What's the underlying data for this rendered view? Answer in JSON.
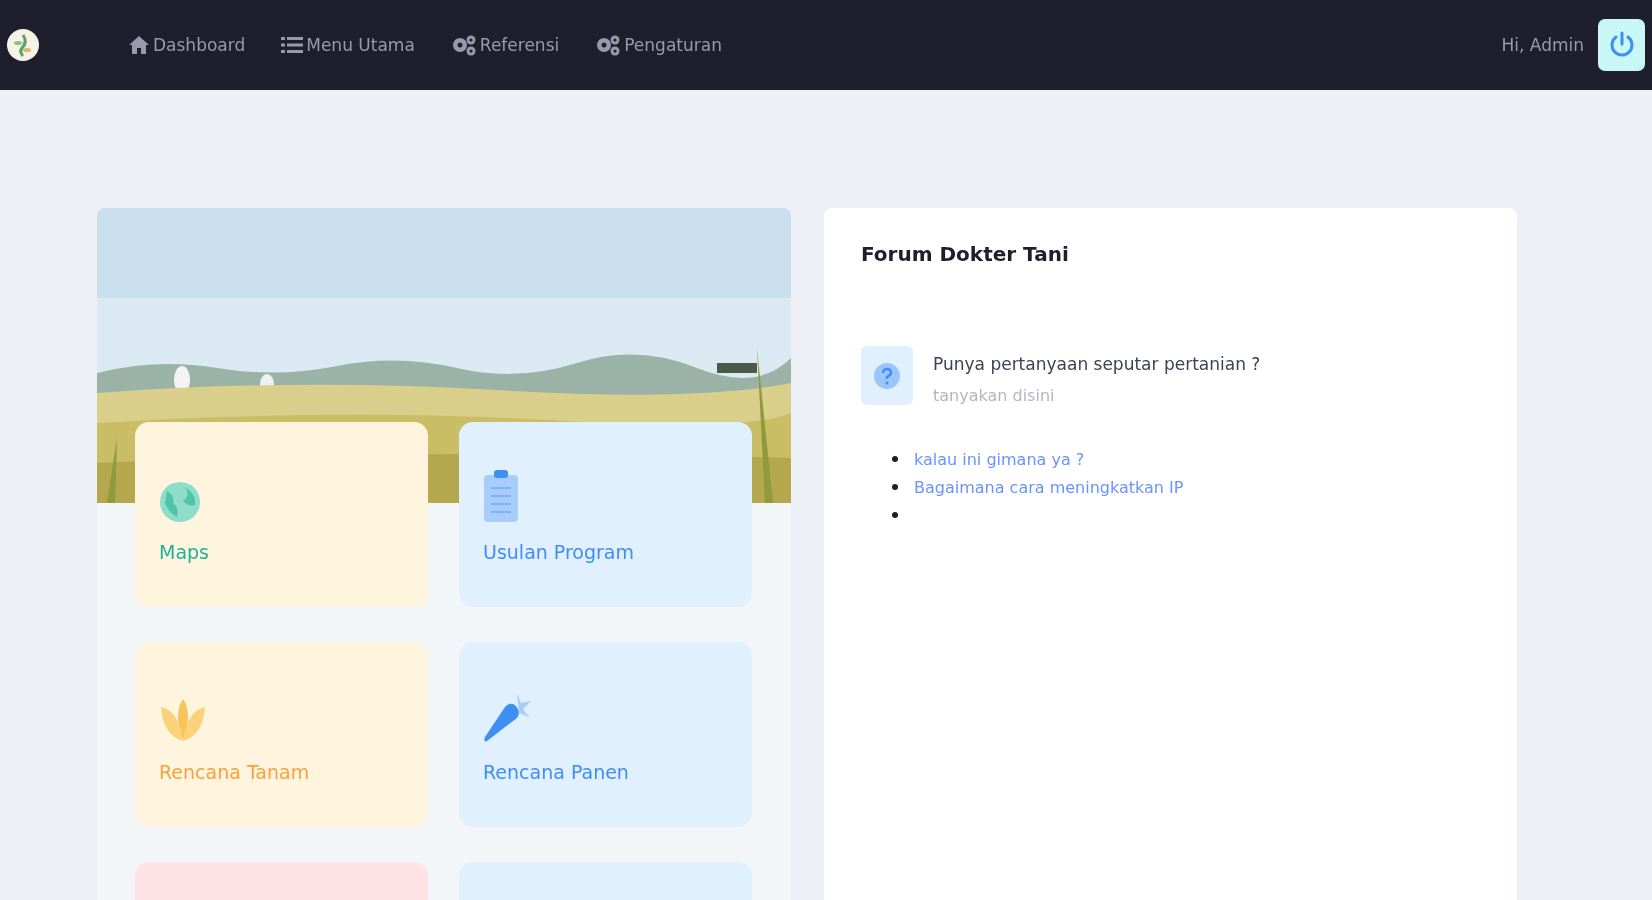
{
  "navbar": {
    "menu": [
      {
        "kind": "home",
        "label": "Dashboard"
      },
      {
        "kind": "list",
        "label": "Menu Utama"
      },
      {
        "kind": "gears",
        "label": "Referensi"
      },
      {
        "kind": "gears",
        "label": "Pengaturan"
      }
    ],
    "greeting": "Hi, Admin"
  },
  "tiles": [
    {
      "kind": "globe",
      "label": "Maps",
      "color": "#fff4de"
    },
    {
      "kind": "clipboard",
      "label": "Usulan Program",
      "color": "#e1f0ff"
    },
    {
      "kind": "lotus",
      "label": "Rencana Tanam",
      "color": "#fff4de"
    },
    {
      "kind": "carrot",
      "label": "Rencana Panen",
      "color": "#e1f0ff"
    },
    {
      "kind": "blank",
      "color": "#ffe2e5"
    },
    {
      "kind": "blank",
      "color": "#e1f0ff"
    }
  ],
  "forum": {
    "title": "Forum Dokter Tani",
    "prompt": {
      "question": "Punya pertanyaan seputar pertanian ?",
      "hint": "tanyakan disini"
    },
    "questions": [
      {
        "kind": "link",
        "text": "kalau ini gimana ya ?"
      },
      {
        "kind": "link",
        "text": "Bagaimana cara meningkatkan IP"
      },
      {
        "kind": "blank"
      }
    ]
  }
}
